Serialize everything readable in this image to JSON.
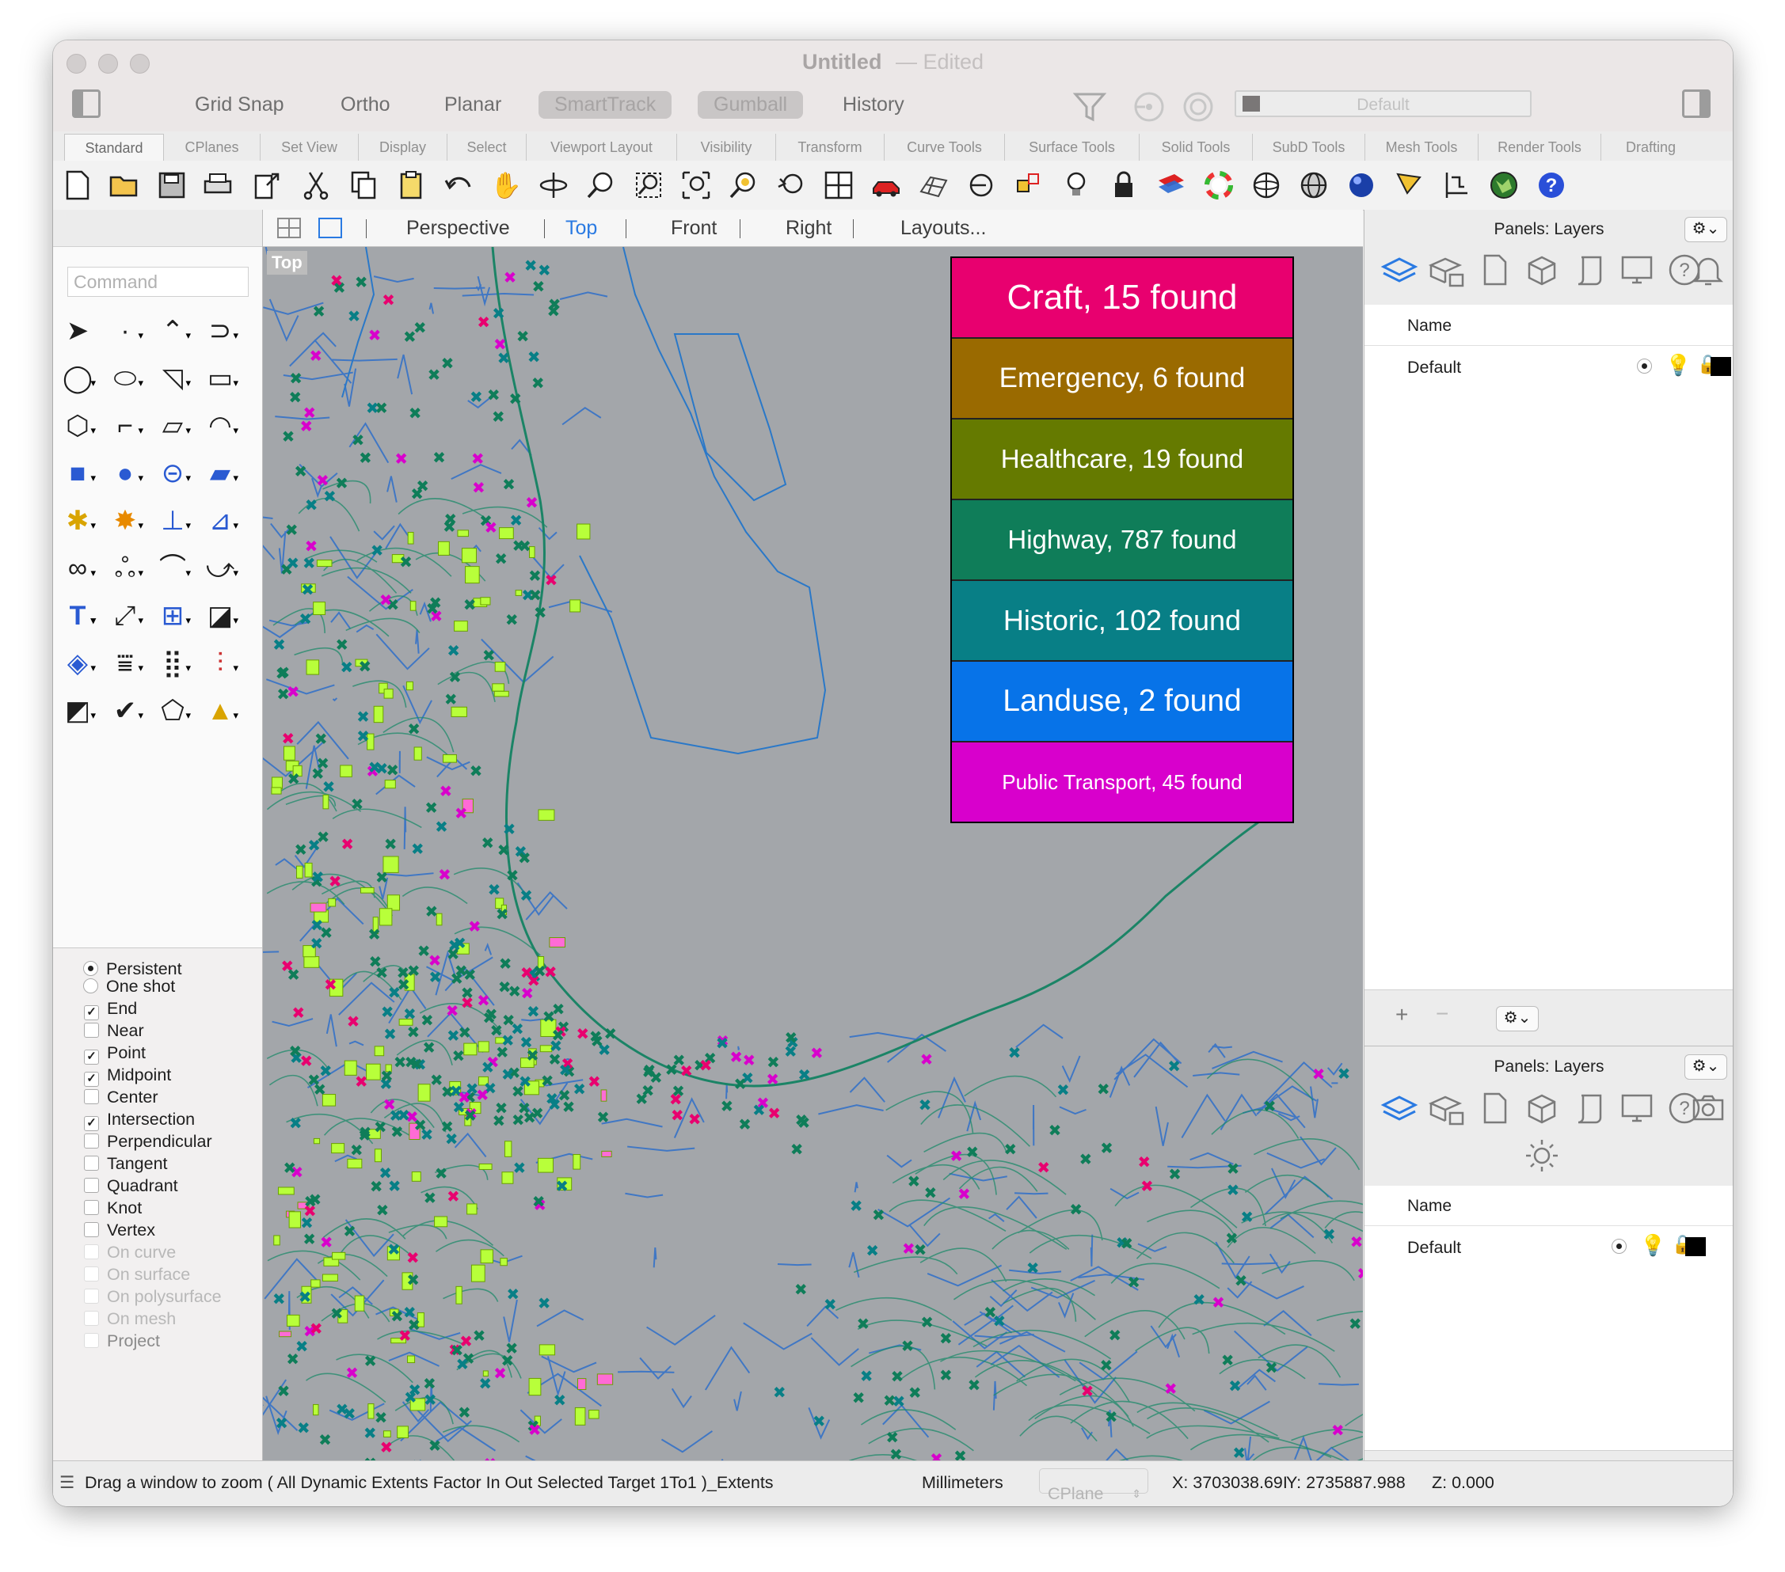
{
  "window": {
    "title": "Untitled",
    "edited": "Edited"
  },
  "toolbar": {
    "toggles": [
      {
        "label": "Grid Snap",
        "active": false
      },
      {
        "label": "Ortho",
        "active": false
      },
      {
        "label": "Planar",
        "active": false
      },
      {
        "label": "SmartTrack",
        "active": true
      },
      {
        "label": "Gumball",
        "active": true
      },
      {
        "label": "History",
        "active": false
      }
    ],
    "layer_dropdown": "Default"
  },
  "tabs": [
    "Standard",
    "CPlanes",
    "Set View",
    "Display",
    "Select",
    "Viewport Layout",
    "Visibility",
    "Transform",
    "Curve Tools",
    "Surface Tools",
    "Solid Tools",
    "SubD Tools",
    "Mesh Tools",
    "Render Tools",
    "Drafting"
  ],
  "standard_icons": [
    "new-file-icon",
    "open-folder-icon",
    "save-icon",
    "print-icon",
    "export-icon",
    "cut-icon",
    "copy-icon",
    "paste-icon",
    "undo-icon",
    "pan-hand-icon",
    "rotate-view-icon",
    "zoom-icon",
    "zoom-window-icon",
    "zoom-extents-icon",
    "zoom-selected-icon",
    "undo-view-icon",
    "viewport-layout-icon",
    "car-icon",
    "grid-icon",
    "point-on-curve-icon",
    "transform-points-icon",
    "light-bulb-icon",
    "lock-icon",
    "layer-color-icon",
    "color-wheel-icon",
    "wireframe-sphere-icon",
    "grid-sphere-icon",
    "shaded-sphere-icon",
    "flag-icon",
    "dimension-icon",
    "globe-icon",
    "help-icon"
  ],
  "command": {
    "placeholder": "Command"
  },
  "osnap": {
    "mode": [
      {
        "label": "Persistent",
        "selected": true
      },
      {
        "label": "One shot",
        "selected": false
      }
    ],
    "items": [
      {
        "label": "End",
        "checked": true,
        "enabled": true
      },
      {
        "label": "Near",
        "checked": false,
        "enabled": true
      },
      {
        "label": "Point",
        "checked": true,
        "enabled": true
      },
      {
        "label": "Midpoint",
        "checked": true,
        "enabled": true
      },
      {
        "label": "Center",
        "checked": false,
        "enabled": true
      },
      {
        "label": "Intersection",
        "checked": true,
        "enabled": true
      },
      {
        "label": "Perpendicular",
        "checked": false,
        "enabled": true
      },
      {
        "label": "Tangent",
        "checked": false,
        "enabled": true
      },
      {
        "label": "Quadrant",
        "checked": false,
        "enabled": true
      },
      {
        "label": "Knot",
        "checked": false,
        "enabled": true
      },
      {
        "label": "Vertex",
        "checked": false,
        "enabled": true
      },
      {
        "label": "On curve",
        "checked": false,
        "enabled": false
      },
      {
        "label": "On surface",
        "checked": false,
        "enabled": false
      },
      {
        "label": "On polysurface",
        "checked": false,
        "enabled": false
      },
      {
        "label": "On mesh",
        "checked": false,
        "enabled": false
      },
      {
        "label": "Project",
        "checked": false,
        "enabled": false
      }
    ]
  },
  "viewport": {
    "tabs": [
      {
        "label": "Perspective",
        "active": false
      },
      {
        "label": "Top",
        "active": true
      },
      {
        "label": "Front",
        "active": false
      },
      {
        "label": "Right",
        "active": false
      },
      {
        "label": "Layouts...",
        "active": false
      }
    ],
    "label": "Top",
    "legend": [
      {
        "text": "Craft, 15 found",
        "color": "#e8006f"
      },
      {
        "text": "Emergency, 6 found",
        "color": "#9a6a00"
      },
      {
        "text": "Healthcare, 19 found",
        "color": "#657a00"
      },
      {
        "text": "Highway, 787 found",
        "color": "#0f7d59"
      },
      {
        "text": "Historic, 102 found",
        "color": "#087f86"
      },
      {
        "text": "Landuse, 2 found",
        "color": "#0773e8"
      },
      {
        "text": "Public Transport, 45 found",
        "color": "#d800cc"
      }
    ]
  },
  "panels": [
    {
      "title": "Panels: Layers",
      "column": "Name",
      "rows": [
        {
          "name": "Default"
        }
      ]
    },
    {
      "title": "Panels: Layers",
      "column": "Name",
      "rows": [
        {
          "name": "Default"
        }
      ]
    }
  ],
  "status": {
    "prompt": "Drag a window to zoom ( All Dynamic Extents Factor In Out Selected Target 1To1 )_Extents",
    "units": "Millimeters",
    "cplane": "CPlane",
    "x": "X: 3703038.69Ι",
    "y": "Y: 2735887.988",
    "z": "Z: 0.000"
  },
  "colors": {
    "highway": "#0f7d59",
    "historic": "#087f86",
    "craft": "#e8006f",
    "transport": "#d800cc",
    "parcels": "#b8ff3a",
    "streets": "#2f6fc9"
  }
}
